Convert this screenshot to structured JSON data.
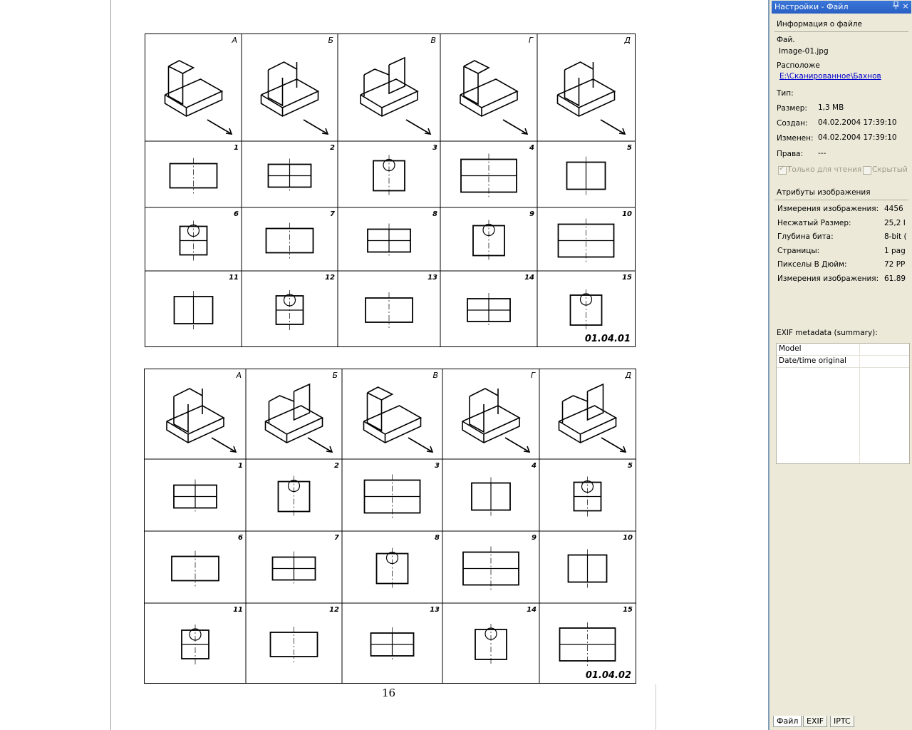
{
  "document": {
    "sheet1_code": "01.04.01",
    "sheet2_code": "01.04.02",
    "column_letters": [
      "А",
      "Б",
      "В",
      "Г",
      "Д"
    ],
    "view_numbers": [
      "1",
      "2",
      "3",
      "4",
      "5",
      "6",
      "7",
      "8",
      "9",
      "10",
      "11",
      "12",
      "13",
      "14",
      "15"
    ],
    "page_number": "16"
  },
  "panel": {
    "title": "Настройки - Файл",
    "pin_icon": "pin-icon",
    "close_label": "×",
    "file_info_header": "Информация о файле",
    "file_label": "Фай.",
    "file_value": "Image-01.jpg",
    "location_label": "Расположе",
    "location_value": "E:\\Сканированное\\Бахнов",
    "type_label": "Тип:",
    "size_label": "Размер:",
    "size_value": "1,3 MB",
    "created_label": "Создан:",
    "created_value": "04.02.2004 17:39:10",
    "modified_label": "Изменен:",
    "modified_value": "04.02.2004 17:39:10",
    "rights_label": "Права:",
    "rights_value": "---",
    "readonly_label": "Только для чтения",
    "hidden_label": "Скрытый",
    "image_attrs_header": "Атрибуты изображения",
    "attrs": [
      {
        "label": "Измерения изображения:",
        "value": "4456"
      },
      {
        "label": "Несжатый Размер:",
        "value": "25,2 I"
      },
      {
        "label": "Глубина бита:",
        "value": "8-bit ("
      },
      {
        "label": "Страницы:",
        "value": "1 pag"
      },
      {
        "label": "Пикселы В Дюйм:",
        "value": "72 PP"
      },
      {
        "label": "Измерения изображения:",
        "value": "61.89"
      }
    ],
    "exif_header": "EXIF metadata (summary):",
    "exif_rows": [
      "Model",
      "Date/time original"
    ],
    "tabs": [
      "Файл",
      "EXIF",
      "IPTC"
    ]
  }
}
